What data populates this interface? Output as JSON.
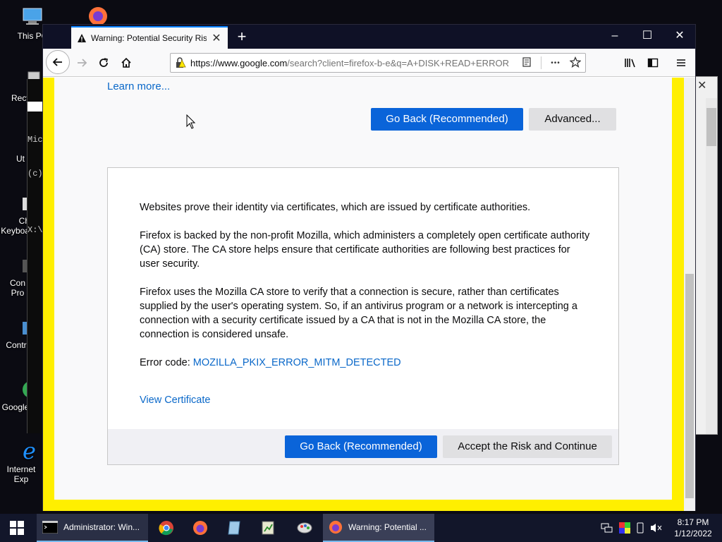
{
  "desktop": {
    "icons": [
      {
        "label": "This PC",
        "icon": "computer-icon"
      },
      {
        "label": "Recy",
        "icon": "recycle-bin-icon"
      },
      {
        "label": "Ut",
        "icon": "folder-icon"
      },
      {
        "label": "Ch Keyboa",
        "icon": "keyboard-icon"
      },
      {
        "label": "Con Pro",
        "icon": "control-panel-icon"
      },
      {
        "label": "Contr",
        "icon": "control-icon"
      },
      {
        "label": "Google",
        "icon": "chrome-icon"
      },
      {
        "label": "Internet Exp",
        "icon": "internet-explorer-icon"
      }
    ],
    "cmd_lines": [
      "Mic",
      "(c)",
      "",
      "X:\\"
    ]
  },
  "browser": {
    "tab_title": "Warning: Potential Security Risk Ahead",
    "new_tab": "+",
    "window_controls": {
      "minimize": "–",
      "maximize": "☐",
      "close": "✕"
    },
    "url_domain": "https://www.google.com",
    "url_rest": "/search?client=firefox-b-e&q=A+DISK+READ+ERROR",
    "menu_dots": "•••"
  },
  "page": {
    "learn_more": "Learn more...",
    "go_back_top": "Go Back (Recommended)",
    "advanced": "Advanced...",
    "para1": "Websites prove their identity via certificates, which are issued by certificate authorities.",
    "para2": "Firefox is backed by the non-profit Mozilla, which administers a completely open certificate authority (CA) store. The CA store helps ensure that certificate authorities are following best practices for user security.",
    "para3": "Firefox uses the Mozilla CA store to verify that a connection is secure, rather than certificates supplied by the user's operating system. So, if an antivirus program or a network is intercepting a connection with a security certificate issued by a CA that is not in the Mozilla CA store, the connection is considered unsafe.",
    "error_code_label": "Error code: ",
    "error_code": "MOZILLA_PKIX_ERROR_MITM_DETECTED",
    "view_certificate": "View Certificate",
    "go_back_bottom": "Go Back (Recommended)",
    "accept_risk": "Accept the Risk and Continue"
  },
  "taskbar": {
    "cmd_app": "Administrator: Win...",
    "firefox_app": "Warning: Potential ...",
    "time": "8:17 PM",
    "date": "1/12/2022"
  },
  "colors": {
    "accent_blue": "#0a64d9",
    "highlight_yellow": "#ffef00",
    "link": "#0a68c9"
  }
}
